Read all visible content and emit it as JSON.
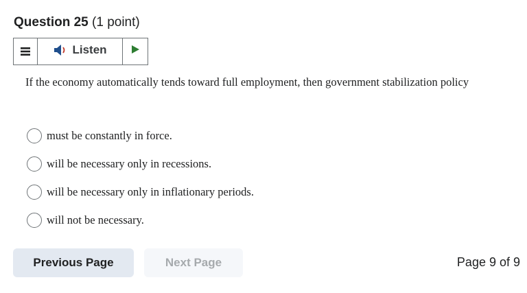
{
  "question": {
    "title": "Question 25",
    "points": "(1 point)"
  },
  "listen_bar": {
    "menu_icon": "hamburger-icon",
    "speaker_icon": "speaker-icon",
    "listen_label": "Listen",
    "play_icon": "play-icon",
    "colors": {
      "speaker": "#1f4e8c",
      "speaker_wave": "#c0392b",
      "play": "#2e7d32"
    }
  },
  "stem": "If the economy automatically tends toward full employment, then government stabilization policy",
  "options": [
    {
      "label": "must be constantly in force."
    },
    {
      "label": "will be necessary only in recessions."
    },
    {
      "label": "will be necessary only in inflationary periods."
    },
    {
      "label": "will not be necessary."
    }
  ],
  "navigation": {
    "previous_label": "Previous Page",
    "next_label": "Next Page",
    "page_indicator": "Page 9 of 9"
  }
}
